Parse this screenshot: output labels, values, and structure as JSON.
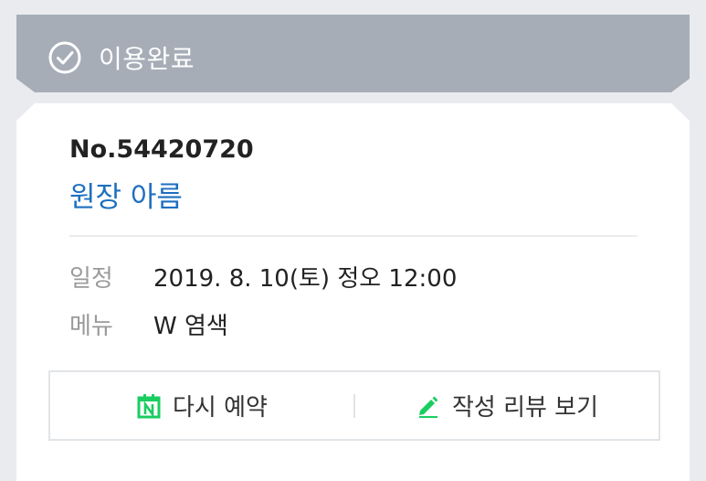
{
  "status": {
    "label": "이용완료",
    "icon": "check-circle-icon"
  },
  "booking": {
    "number": "No.54420720",
    "shop_name": "원장 아름"
  },
  "details": {
    "schedule_label": "일정",
    "schedule_value": "2019. 8. 10(토) 정오 12:00",
    "menu_label": "메뉴",
    "menu_value": "W 염색"
  },
  "actions": {
    "rebook_label": "다시 예약",
    "rebook_icon": "naver-calendar-icon",
    "review_label": "작성 리뷰 보기",
    "review_icon": "pencil-icon"
  },
  "colors": {
    "header_bg": "#a6adb7",
    "shop_name": "#1d6fc0",
    "naver_green": "#19ce60",
    "page_bg": "#e9ebef"
  }
}
